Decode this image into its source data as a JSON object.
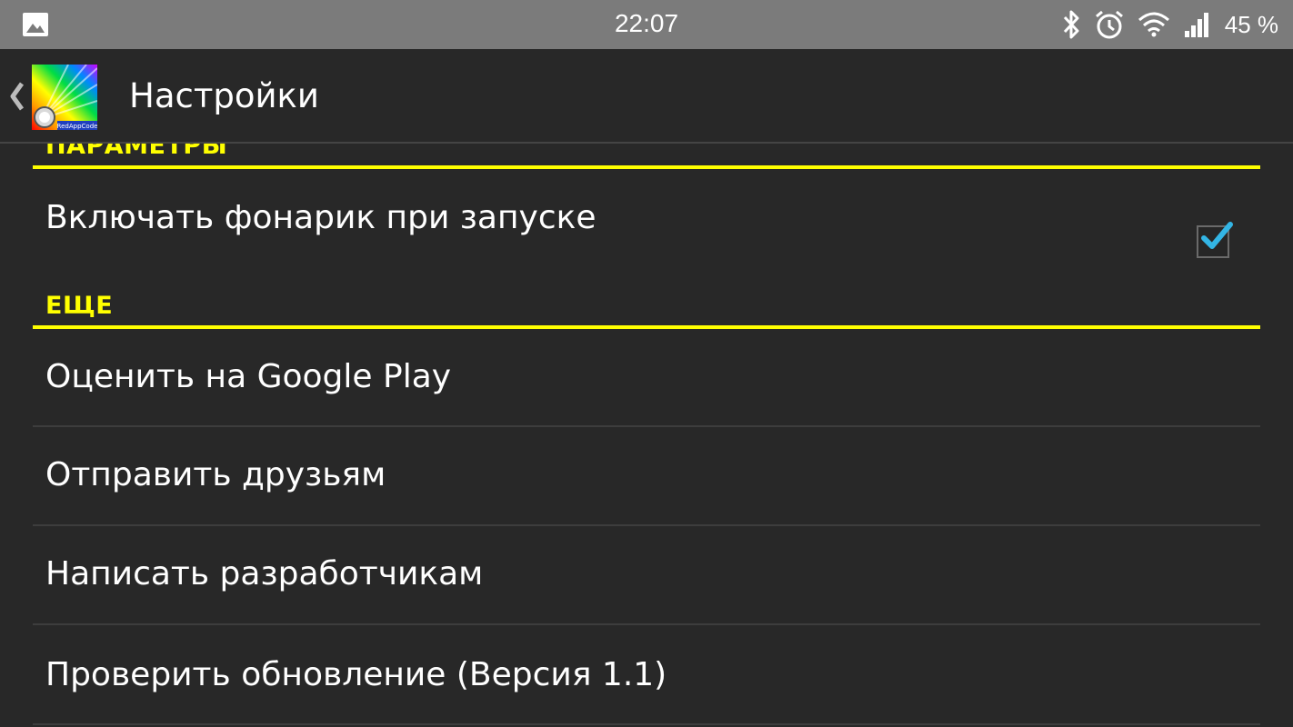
{
  "status_bar": {
    "time": "22:07",
    "battery": "45 %",
    "icons": [
      "image-icon",
      "bluetooth-icon",
      "alarm-icon",
      "wifi-icon",
      "signal-icon"
    ]
  },
  "action_bar": {
    "title": "Настройки",
    "app_icon_caption": "RedAppCode"
  },
  "sections": [
    {
      "header": "ПАРАМЕТРЫ",
      "items": [
        {
          "label": "Включать фонарик при запуске",
          "checked": true
        }
      ]
    },
    {
      "header": "ЕЩЕ",
      "items": [
        {
          "label": "Оценить на Google Play"
        },
        {
          "label": "Отправить друзьям"
        },
        {
          "label": "Написать разработчикам"
        },
        {
          "label": "Проверить обновление (Версия 1.1)"
        }
      ]
    }
  ],
  "colors": {
    "accent": "#ffff00",
    "background": "#282828",
    "status_bar": "#7b7b7b",
    "check": "#33b5e5"
  }
}
